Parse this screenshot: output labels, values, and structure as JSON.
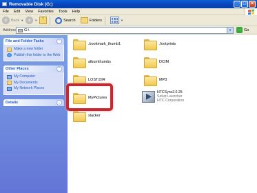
{
  "window": {
    "title": "Removable Disk (G:)",
    "btn_min": "_",
    "btn_max": "□",
    "btn_close": "×"
  },
  "menu": [
    "File",
    "Edit",
    "View",
    "Favorites",
    "Tools",
    "Help"
  ],
  "toolbar": {
    "back": "Back",
    "forward_arrow": "›",
    "back_arrow": "‹",
    "search": "Search",
    "folders": "Folders"
  },
  "address": {
    "label": "Address",
    "value": "G:\\",
    "go": "Go"
  },
  "panels": {
    "file_tasks": {
      "title": "File and Folder Tasks",
      "items": [
        "Make a new folder",
        "Publish this folder to the Web"
      ]
    },
    "other_places": {
      "title": "Other Places",
      "items": [
        "My Computer",
        "My Documents",
        "My Network Places"
      ]
    },
    "details": {
      "title": "Details"
    }
  },
  "files": [
    {
      "name": ".bookmark_thumb1",
      "type": "folder"
    },
    {
      "name": ".footprints",
      "type": "folder"
    },
    {
      "name": "albumthumbs",
      "type": "folder"
    },
    {
      "name": "DCIM",
      "type": "folder"
    },
    {
      "name": "LOST.DIR",
      "type": "folder"
    },
    {
      "name": "MP3",
      "type": "folder"
    },
    {
      "name": "MyPictures",
      "type": "folder",
      "highlighted": true
    },
    {
      "name": "HTCSync2.0.25",
      "type": "app",
      "line2": "Setup Launcher",
      "line3": "HTC Corporation"
    },
    {
      "name": "slacker",
      "type": "folder"
    }
  ],
  "colors": {
    "highlight": "#c8272e",
    "titlebar": "#0843b8",
    "task_link": "#215dc6"
  }
}
